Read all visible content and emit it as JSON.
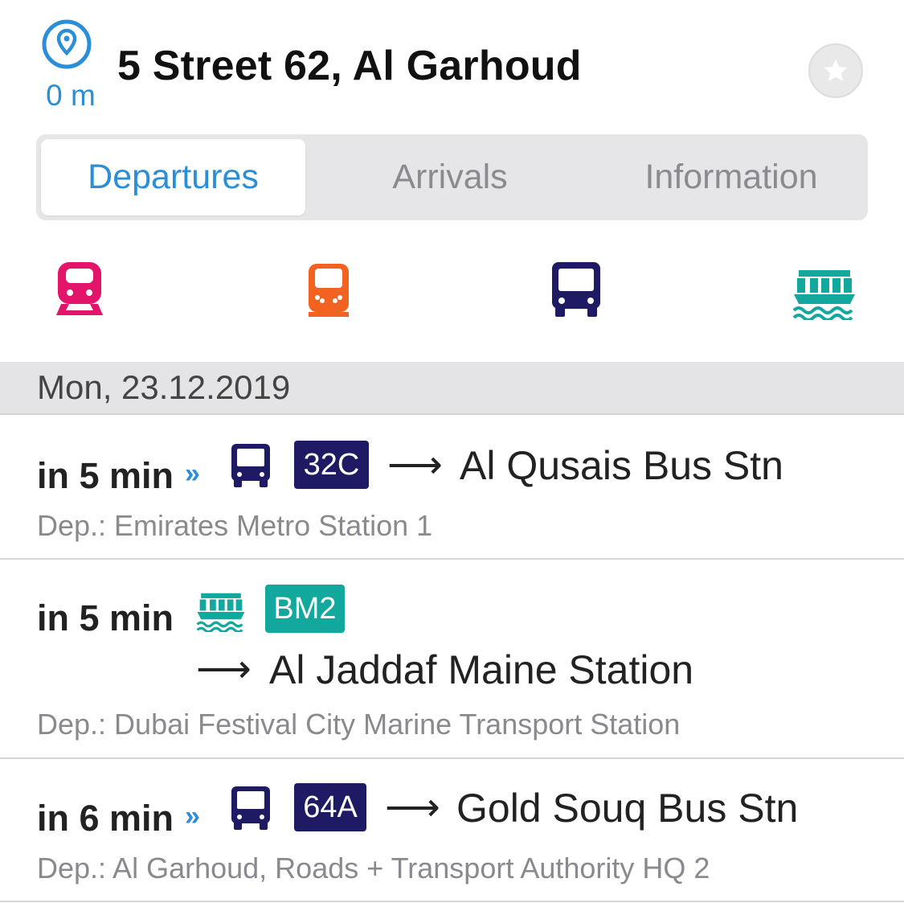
{
  "header": {
    "distance": "0 m",
    "title": "5 Street 62, Al Garhoud",
    "pin_icon": "location-pin-icon",
    "favorite_icon": "star-icon"
  },
  "tabs": [
    {
      "label": "Departures",
      "active": true
    },
    {
      "label": "Arrivals",
      "active": false
    },
    {
      "label": "Information",
      "active": false
    }
  ],
  "modes": [
    {
      "name": "metro",
      "icon": "metro-icon",
      "color": "#e2156b"
    },
    {
      "name": "tram",
      "icon": "tram-icon",
      "color": "#f26322"
    },
    {
      "name": "bus",
      "icon": "bus-icon",
      "color": "#1e1a63"
    },
    {
      "name": "ferry",
      "icon": "ferry-icon",
      "color": "#13a89e"
    }
  ],
  "date": "Mon, 23.12.2019",
  "departures": [
    {
      "when": "in 5 min",
      "realtime": "»",
      "mode_icon": "bus-icon",
      "line": "32C",
      "line_color": "#1e1a63",
      "arrow": "⟶",
      "destination": "Al Qusais Bus Stn",
      "departure_stop": "Dep.: Emirates Metro Station 1"
    },
    {
      "when": "in 5 min",
      "realtime": "",
      "mode_icon": "ferry-icon",
      "line": "BM2",
      "line_color": "#13a89e",
      "arrow": "⟶",
      "destination": "Al Jaddaf Maine Station",
      "departure_stop": "Dep.: Dubai Festival City Marine Transport Station"
    },
    {
      "when": "in 6 min",
      "realtime": "»",
      "mode_icon": "bus-icon",
      "line": "64A",
      "line_color": "#1e1a63",
      "arrow": "⟶",
      "destination": "Gold Souq Bus Stn",
      "departure_stop": "Dep.: Al Garhoud, Roads + Transport Authority HQ 2"
    }
  ],
  "colors": {
    "accent": "#2a8fd8",
    "bus": "#1e1a63",
    "ferry": "#13a89e"
  }
}
